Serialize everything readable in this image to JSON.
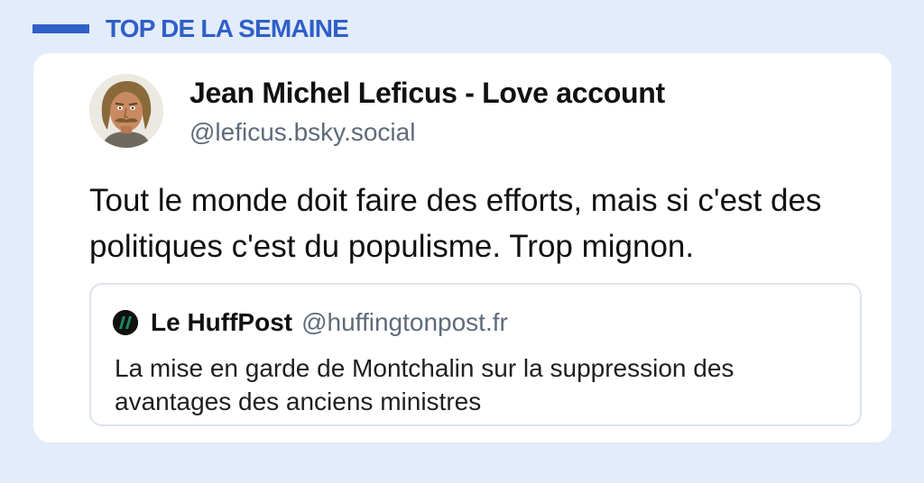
{
  "section": {
    "title": "TOP DE LA SEMAINE",
    "accent_color": "#2f5fc8"
  },
  "post": {
    "avatar_icon": "profile-photo-man-with-mustache",
    "author_name": "Jean Michel Leficus - Love account",
    "author_handle": "@leficus.bsky.social",
    "text": "Tout le monde doit faire des efforts, mais si c'est des politiques c'est du populisme. Trop mignon.",
    "quote": {
      "logo_icon": "huffpost-logo-icon",
      "logo_color": "#1d8a5c",
      "author_name": "Le HuffPost",
      "author_handle": "@huffingtonpost.fr",
      "text": "La mise en garde de Montchalin sur la suppression des avantages des anciens ministres"
    }
  }
}
